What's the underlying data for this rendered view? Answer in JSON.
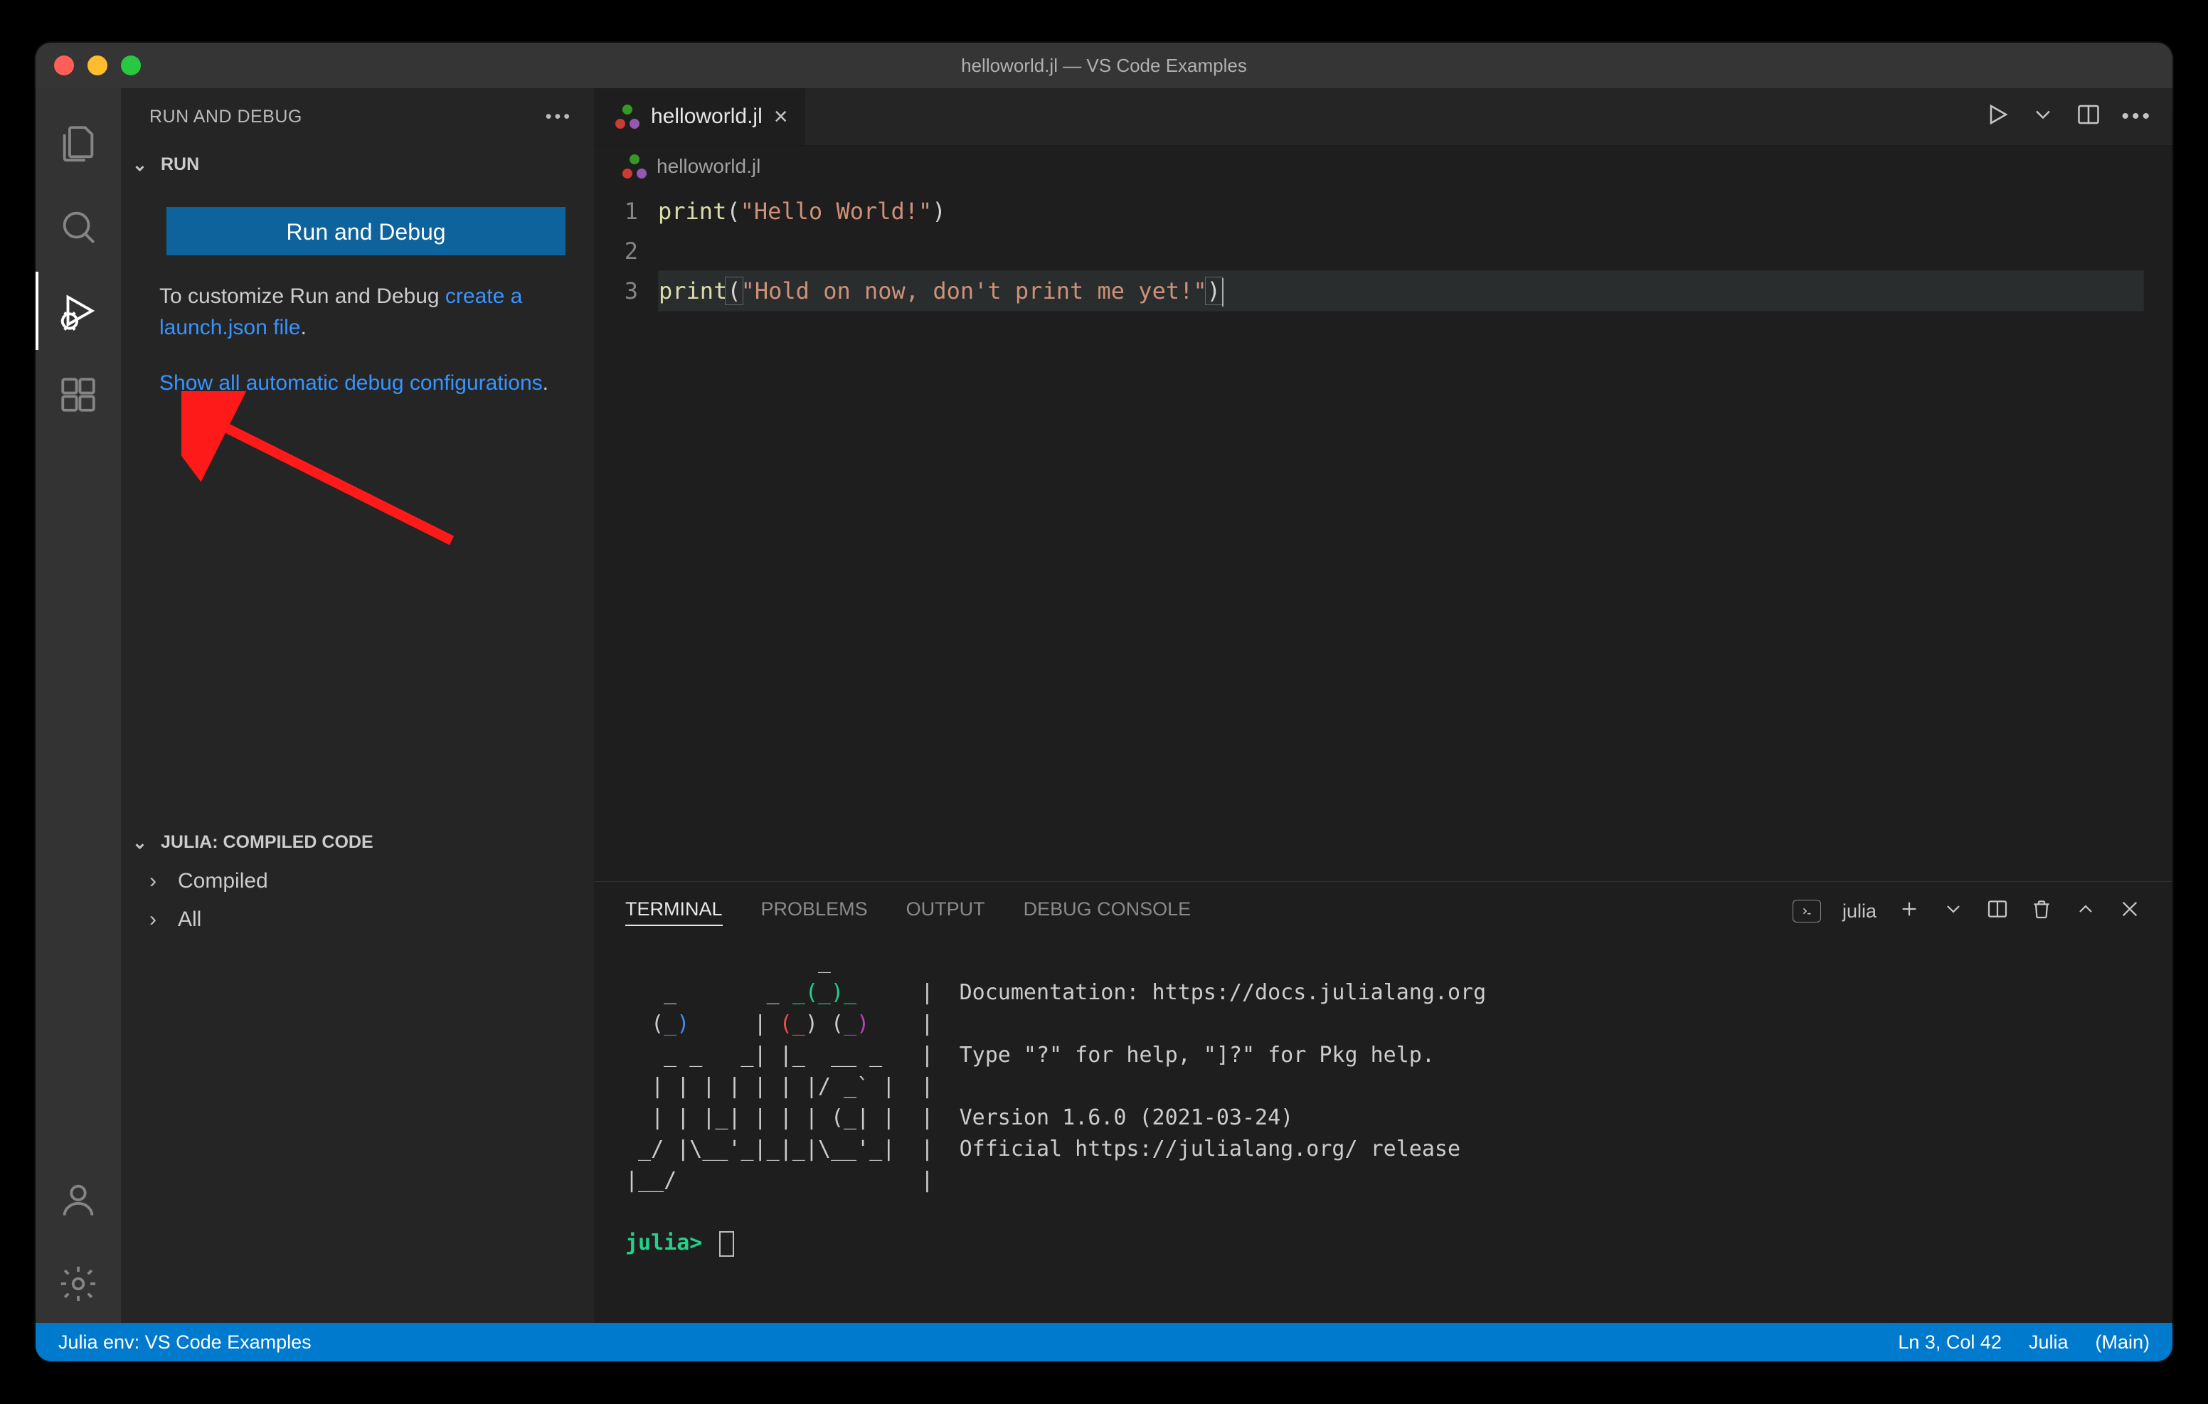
{
  "window": {
    "title": "helloworld.jl — VS Code Examples"
  },
  "activitybar": {
    "items": [
      "explorer",
      "search",
      "run-debug",
      "extensions"
    ],
    "bottom": [
      "account",
      "settings"
    ],
    "active": "run-debug"
  },
  "sidebar": {
    "title": "RUN AND DEBUG",
    "run_section": "RUN",
    "run_debug_button": "Run and Debug",
    "customize_text_pre": "To customize Run and Debug ",
    "customize_link": "create a launch.json file",
    "customize_text_post": ".",
    "show_all_link": "Show all automatic debug configurations",
    "show_all_post": ".",
    "compiled_section": "JULIA: COMPILED CODE",
    "tree": {
      "compiled": "Compiled",
      "all": "All"
    }
  },
  "tabs": {
    "active": {
      "filename": "helloworld.jl"
    }
  },
  "breadcrumbs": {
    "file": "helloworld.jl"
  },
  "editor": {
    "language": "julia",
    "lines": [
      {
        "n": "1",
        "tokens": [
          [
            "fn",
            "print"
          ],
          [
            "",
            "("
          ],
          [
            "str",
            "\"Hello World!\""
          ],
          [
            "",
            ")"
          ]
        ]
      },
      {
        "n": "2",
        "tokens": []
      },
      {
        "n": "3",
        "cursor_line": true,
        "tokens": [
          [
            "fn",
            "print"
          ],
          [
            "br",
            "("
          ],
          [
            "str",
            "\"Hold on now, don't print me yet!\""
          ],
          [
            "br",
            ")"
          ],
          [
            "caret",
            ""
          ]
        ]
      }
    ]
  },
  "panel": {
    "tabs": {
      "terminal": "TERMINAL",
      "problems": "PROBLEMS",
      "output": "OUTPUT",
      "debug": "DEBUG CONSOLE"
    },
    "active": "terminal",
    "terminal_name": "julia",
    "terminal_lines": [
      "               _",
      "   _       _ _(_)_     |  Documentation: https://docs.julialang.org",
      "  (_)     | (_) (_)    |",
      "   _ _   _| |_  __ _   |  Type \"?\" for help, \"]?\" for Pkg help.",
      "  | | | | | | |/ _` |  |",
      "  | | |_| | | | (_| |  |  Version 1.6.0 (2021-03-24)",
      " _/ |\\__'_|_|_|\\__'_|  |  Official https://julialang.org/ release",
      "|__/                   |"
    ],
    "prompt": "julia>"
  },
  "statusbar": {
    "left": "Julia env: VS Code Examples",
    "line_col": "Ln 3, Col 42",
    "lang": "Julia",
    "branch": "(Main)"
  },
  "colors": {
    "accent": "#0e639c",
    "link": "#3794ff",
    "syntax_string": "#ce9178",
    "syntax_func": "#dcdcaa",
    "logo_blue": "#3b8eea",
    "logo_red": "#f14c4c",
    "logo_green": "#23d18b",
    "logo_purple": "#bc3fbc"
  }
}
